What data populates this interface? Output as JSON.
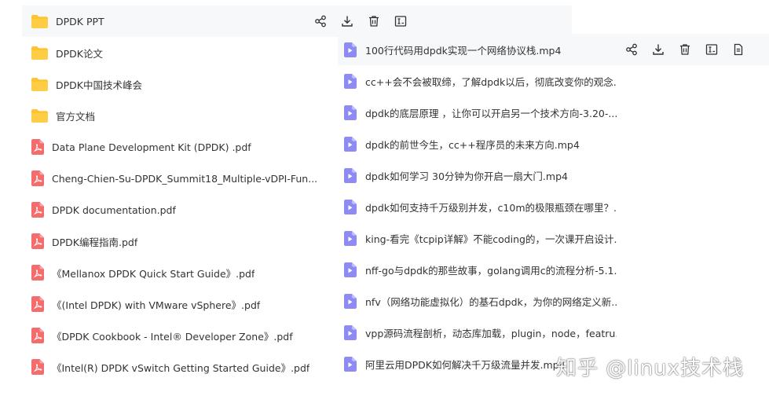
{
  "left_list": [
    {
      "type": "folder",
      "name": "DPDK  PPT"
    },
    {
      "type": "folder",
      "name": "DPDK论文"
    },
    {
      "type": "folder",
      "name": "DPDK中国技术峰会"
    },
    {
      "type": "folder",
      "name": "官方文档"
    },
    {
      "type": "pdf",
      "name": "Data Plane Development Kit (DPDK) .pdf"
    },
    {
      "type": "pdf",
      "name": "Cheng-Chien-Su-DPDK_Summit18_Multiple-vDPI-Fun..."
    },
    {
      "type": "pdf",
      "name": "DPDK documentation.pdf"
    },
    {
      "type": "pdf",
      "name": "DPDK编程指南.pdf"
    },
    {
      "type": "pdf",
      "name": "《Mellanox DPDK Quick Start Guide》.pdf"
    },
    {
      "type": "pdf",
      "name": "《(Intel DPDK) with VMware vSphere》.pdf"
    },
    {
      "type": "pdf",
      "name": "《DPDK Cookbook - Intel® Developer Zone》.pdf"
    },
    {
      "type": "pdf",
      "name": "《Intel(R) DPDK vSwitch Getting Started Guide》.pdf"
    }
  ],
  "right_list": [
    {
      "name": "100行代码用dpdk实现一个网络协议栈.mp4"
    },
    {
      "name": "cc++会不会被取缔，了解dpdk以后，彻底改变你的观念..."
    },
    {
      "name": "dpdk的底层原理 ，让你可以开启另一个技术方向-3.20-..."
    },
    {
      "name": "dpdk的前世今生，cc++程序员的未来方向.mp4"
    },
    {
      "name": "dpdk如何学习 30分钟为你开启一扇大门.mp4"
    },
    {
      "name": "dpdk如何支持千万级别并发，c10m的极限瓶颈在哪里？..."
    },
    {
      "name": "king-看完《tcpip详解》不能coding的，一次课开启设计..."
    },
    {
      "name": "nff-go与dpdk的那些故事，golang调用c的流程分析-5.1..."
    },
    {
      "name": "nfv（网络功能虚拟化）的基石dpdk，为你的网络定义新..."
    },
    {
      "name": "vpp源码流程剖析，动态库加载，plugin，node，featru..."
    },
    {
      "name": "阿里云用DPDK如何解决千万级流量并发.mp4"
    }
  ],
  "icons": {
    "folder": "folder-icon",
    "pdf": "pdf-icon",
    "video": "video-icon",
    "share": "share-icon",
    "download": "download-icon",
    "delete": "trash-icon",
    "rename": "rename-icon",
    "more": "file-info-icon"
  },
  "colors": {
    "folder": "#ffc530",
    "pdf": "#f56c6c",
    "video": "#8e8cf3",
    "hover_row": "#f7f8fa",
    "action_icon": "#333333"
  },
  "watermark": "知乎 @linux技术栈"
}
